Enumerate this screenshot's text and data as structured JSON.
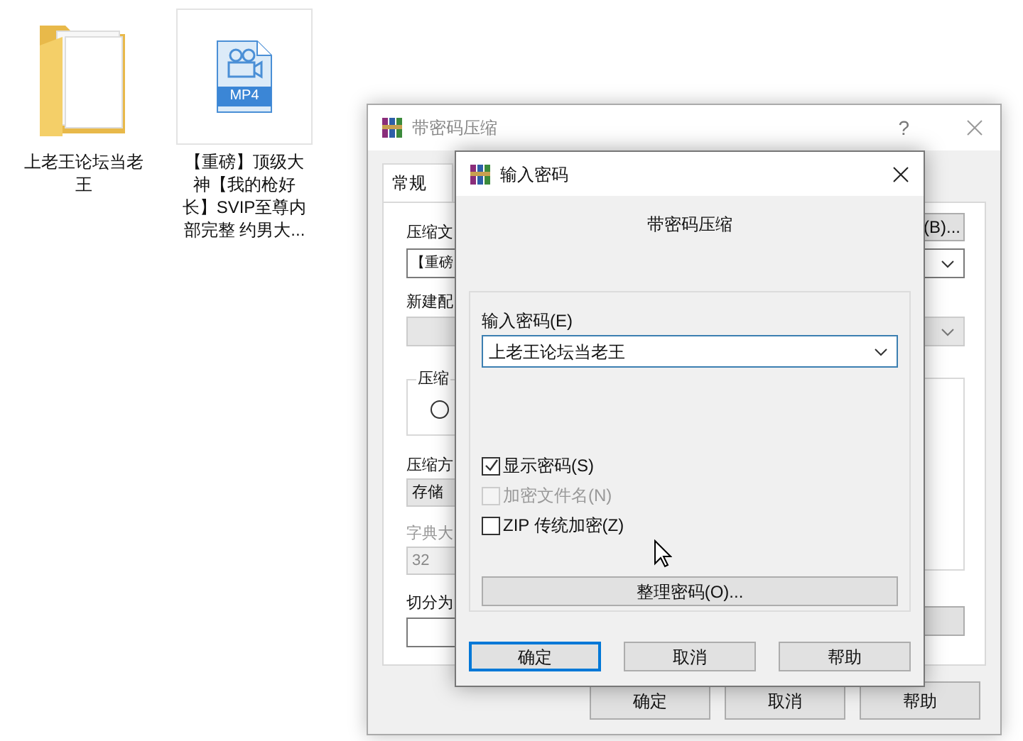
{
  "desktop": {
    "icons": [
      {
        "kind": "folder",
        "label": "上老王论坛当老王",
        "selected": false
      },
      {
        "kind": "video",
        "badge": "MP4",
        "label": "【重磅】顶级大神【我的枪好长】SVIP至尊内部完整 约男大...",
        "selected": true
      }
    ]
  },
  "back_window": {
    "title": "带密码压缩",
    "help": "?",
    "tabs": [
      {
        "label": "常规",
        "selected": true
      }
    ],
    "archive_name": {
      "label": "压缩文",
      "value": "【重磅"
    },
    "browse_button": "(B)...",
    "profile": {
      "label": "新建配",
      "disabled": true
    },
    "format_group": {
      "label": "压缩",
      "radio_selected": false
    },
    "method": {
      "label": "压缩方",
      "value": "存储"
    },
    "dictionary": {
      "label": "字典大",
      "value": "32",
      "disabled": true
    },
    "split": {
      "label": "切分为"
    },
    "buttons": [
      "确定",
      "取消",
      "帮助"
    ]
  },
  "front_dialog": {
    "title": "输入密码",
    "heading": "带密码压缩",
    "password": {
      "label": "输入密码(E)",
      "value": "上老王论坛当老王"
    },
    "checkboxes": [
      {
        "label": "显示密码(S)",
        "checked": true,
        "disabled": false
      },
      {
        "label": "加密文件名(N)",
        "checked": false,
        "disabled": true
      },
      {
        "label": "ZIP 传统加密(Z)",
        "checked": false,
        "disabled": false
      }
    ],
    "organize_button": "整理密码(O)...",
    "buttons": [
      {
        "label": "确定",
        "default": true
      },
      {
        "label": "取消",
        "default": false
      },
      {
        "label": "帮助",
        "default": false
      }
    ]
  }
}
